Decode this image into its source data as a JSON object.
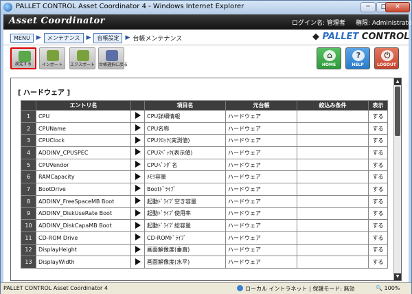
{
  "window": {
    "title": "PALLET CONTROL Asset Coordinator 4 - Windows Internet Explorer",
    "min": "─",
    "max": "□",
    "close": "✕"
  },
  "app": {
    "logo": "Asset Coordinator",
    "user_label": "ログイン名: 管理者",
    "auth_label": "権限: Administrator"
  },
  "breadcrumb": {
    "menu": "MENU",
    "maintenance": "メンテナンス",
    "ledger_settings": "台帳設定",
    "current": "台帳メンテナンス"
  },
  "brand": {
    "prefix": "PALLET",
    "suffix": "CONTROL"
  },
  "toolbar": [
    {
      "label": "設定する",
      "color": "#5aa84a"
    },
    {
      "label": "インポート",
      "color": "#7aa23c"
    },
    {
      "label": "エクスポート",
      "color": "#7aa23c"
    },
    {
      "label": "台帳選択に戻る",
      "color": "#5b6fa6"
    }
  ],
  "nav": {
    "home": {
      "label": "HOME",
      "color": "#2f9a3b"
    },
    "help": {
      "label": "HELP",
      "color": "#2c7bc9"
    },
    "logout": {
      "label": "LOGOUT",
      "color": "#c6452f"
    }
  },
  "section": "[ ハードウェア ]",
  "table": {
    "headers": [
      "エントリ名",
      "項目名",
      "元台帳",
      "絞込み条件",
      "表示"
    ],
    "rows": [
      {
        "no": "1",
        "entry": "CPU",
        "item": "CPU詳細情報",
        "src": "ハードウェア",
        "filter": "",
        "disp": "する"
      },
      {
        "no": "2",
        "entry": "CPUName",
        "item": "CPU名称",
        "src": "ハードウェア",
        "filter": "",
        "disp": "する"
      },
      {
        "no": "3",
        "entry": "CPUClock",
        "item": "CPUｸﾛｯｸ(実測値)",
        "src": "ハードウェア",
        "filter": "",
        "disp": "する"
      },
      {
        "no": "4",
        "entry": "ADDINV_CPUSPEC",
        "item": "CPUｽﾍﾟｯｸ(表示値)",
        "src": "ハードウェア",
        "filter": "",
        "disp": "する"
      },
      {
        "no": "5",
        "entry": "CPUVendor",
        "item": "CPUﾍﾞﾝﾀﾞ名",
        "src": "ハードウェア",
        "filter": "",
        "disp": "する"
      },
      {
        "no": "6",
        "entry": "RAMCapacity",
        "item": "ﾒﾓﾘ容量",
        "src": "ハードウェア",
        "filter": "",
        "disp": "する"
      },
      {
        "no": "7",
        "entry": "BootDrive",
        "item": "Bootﾄﾞﾗｲﾌﾞ",
        "src": "ハードウェア",
        "filter": "",
        "disp": "する"
      },
      {
        "no": "8",
        "entry": "ADDINV_FreeSpaceMB Boot",
        "item": "起動ﾄﾞﾗｲﾌﾞ空き容量",
        "src": "ハードウェア",
        "filter": "",
        "disp": "する"
      },
      {
        "no": "9",
        "entry": "ADDINV_DiskUseRate Boot",
        "item": "起動ﾄﾞﾗｲﾌﾞ使用率",
        "src": "ハードウェア",
        "filter": "",
        "disp": "する"
      },
      {
        "no": "10",
        "entry": "ADDINV_DiskCapaMB Boot",
        "item": "起動ﾄﾞﾗｲﾌﾞ総容量",
        "src": "ハードウェア",
        "filter": "",
        "disp": "する"
      },
      {
        "no": "11",
        "entry": "CD-ROM Drive",
        "item": "CD-ROMﾄﾞﾗｲﾌﾞ",
        "src": "ハードウェア",
        "filter": "",
        "disp": "する"
      },
      {
        "no": "12",
        "entry": "DisplayHeight",
        "item": "画面解像度(垂直)",
        "src": "ハードウェア",
        "filter": "",
        "disp": "する"
      },
      {
        "no": "13",
        "entry": "DisplayWidth",
        "item": "画面解像度(水平)",
        "src": "ハードウェア",
        "filter": "",
        "disp": "する"
      }
    ]
  },
  "status": {
    "left": "PALLET CONTROL Asset Coordinator 4",
    "zone": "ローカル イントラネット | 保護モード: 無効",
    "zoom": "100%"
  }
}
